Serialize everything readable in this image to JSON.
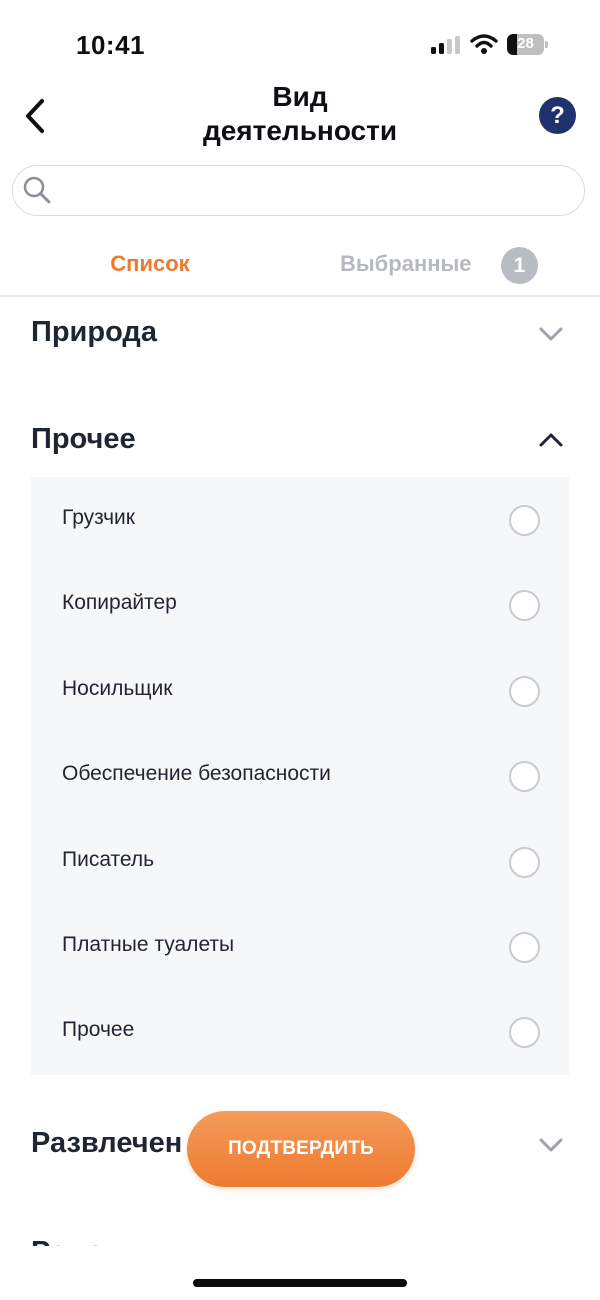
{
  "status_bar": {
    "time": "10:41",
    "battery": "28",
    "battery_level": 0.28
  },
  "header": {
    "title_line1": "Вид",
    "title_line2": "деятельности",
    "help_label": "?"
  },
  "search": {
    "value": "",
    "placeholder": ""
  },
  "tabs": {
    "list_label": "Список",
    "selected_label": "Выбранные",
    "selected_count": "1"
  },
  "sections": [
    {
      "title": "Природа",
      "expanded": false
    },
    {
      "title": "Прочее",
      "expanded": true,
      "items": [
        {
          "label": "Грузчик",
          "selected": false
        },
        {
          "label": "Копирайтер",
          "selected": false
        },
        {
          "label": "Носильщик",
          "selected": false
        },
        {
          "label": "Обеспечение безопасности",
          "selected": false
        },
        {
          "label": "Писатель",
          "selected": false
        },
        {
          "label": "Платные туалеты",
          "selected": false
        },
        {
          "label": "Прочее",
          "selected": false
        }
      ]
    },
    {
      "title": "Развлечен",
      "expanded": false
    },
    {
      "title": "Ремонт",
      "expanded": false
    }
  ],
  "confirm_button": {
    "label": "ПОДТВЕРДИТЬ"
  },
  "colors": {
    "accent": "#ee7a30",
    "help_bg": "#20326e",
    "text": "#1e2533",
    "muted": "#b6b9bf",
    "panel_bg": "#f6f7f9"
  }
}
